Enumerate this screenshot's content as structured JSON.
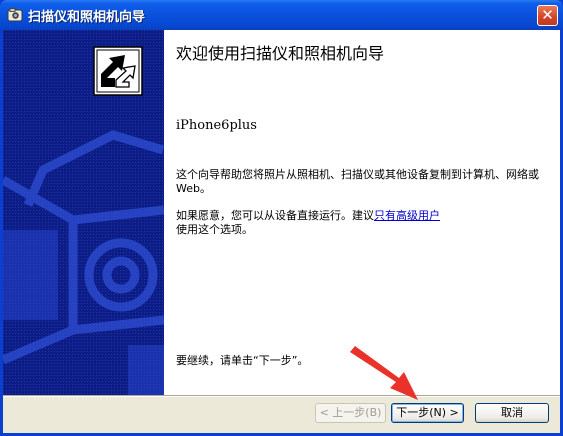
{
  "window": {
    "title": "扫描仪和照相机向导",
    "close_label": "✕"
  },
  "content": {
    "heading": "欢迎使用扫描仪和照相机向导",
    "device_name": "iPhone6plus",
    "paragraph1": "这个向导帮助您将照片从照相机、扫描仪或其他设备复制到计算机、网络或 Web。",
    "paragraph2_prefix": "如果愿意，您可以从设备直接运行。建议",
    "paragraph2_link": "只有高级用户",
    "paragraph2_suffix": "使用这个选项。",
    "continue_text": "要继续，请单击“下一步”。"
  },
  "buttons": {
    "back": "< 上一步(B)",
    "next": "下一步(N) >",
    "cancel": "取消"
  },
  "colors": {
    "title_bar": "#0a4fdc",
    "side_panel": "#0c1d86",
    "link": "#0000cc",
    "annotation_arrow": "#e8322a"
  },
  "icons": {
    "title": "scanner-camera-icon",
    "wizard_logo": "wizard-arrow-icon"
  }
}
